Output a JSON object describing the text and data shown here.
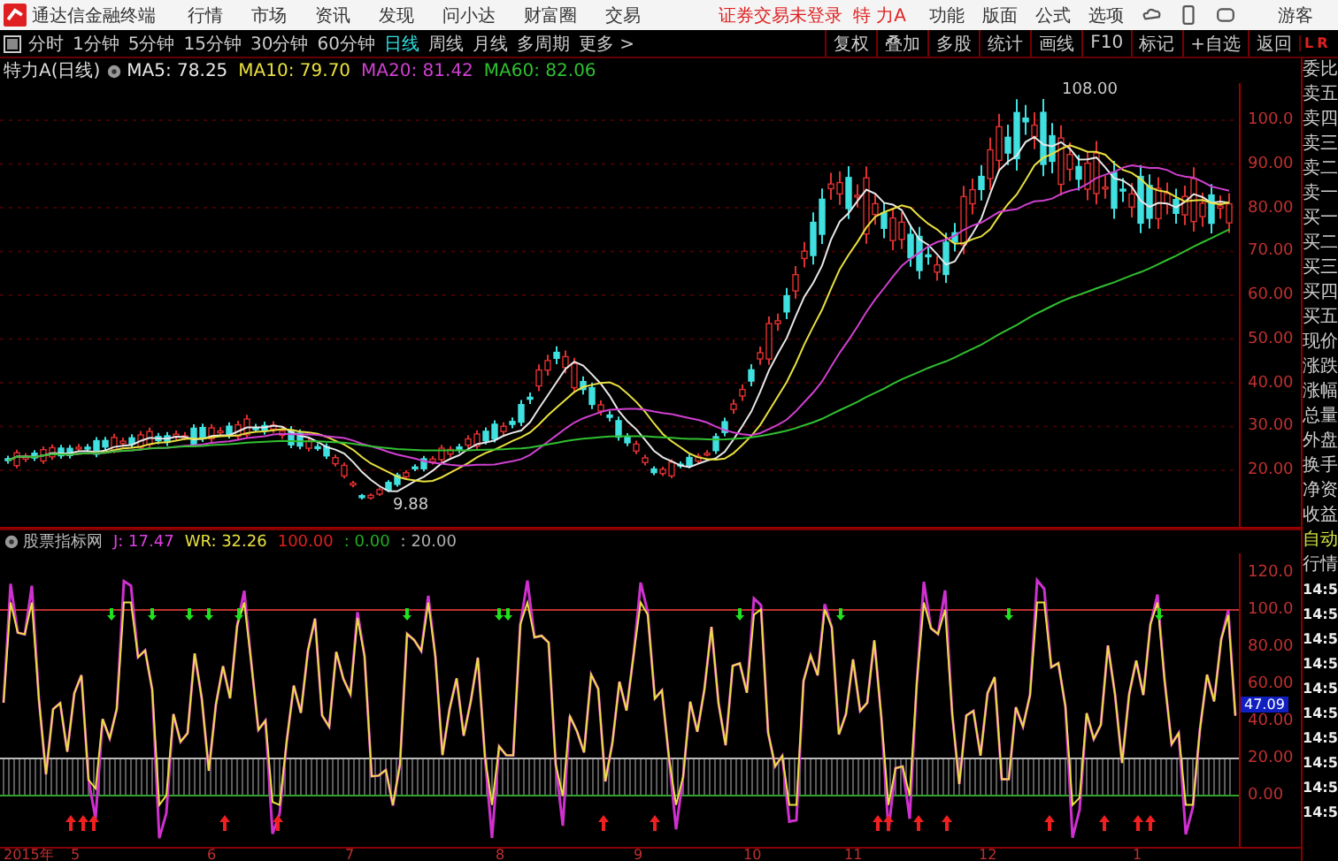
{
  "title_bar": {
    "app_name": "通达信金融终端",
    "menu": [
      "行情",
      "市场",
      "资讯",
      "发现",
      "问小达",
      "财富圈",
      "交易"
    ],
    "login_status": "证券交易未登录",
    "stock": "特 力A",
    "functions": [
      "功能",
      "版面",
      "公式",
      "选项"
    ],
    "user": "游客"
  },
  "period_tabs": [
    {
      "label": "分时",
      "selected": false
    },
    {
      "label": "1分钟",
      "selected": false
    },
    {
      "label": "5分钟",
      "selected": false
    },
    {
      "label": "15分钟",
      "selected": false
    },
    {
      "label": "30分钟",
      "selected": false
    },
    {
      "label": "60分钟",
      "selected": false
    },
    {
      "label": "日线",
      "selected": true
    },
    {
      "label": "周线",
      "selected": false
    },
    {
      "label": "月线",
      "selected": false
    },
    {
      "label": "多周期",
      "selected": false
    },
    {
      "label": "更多 >",
      "selected": false
    }
  ],
  "tool_buttons": [
    "复权",
    "叠加",
    "多股",
    "统计",
    "画线",
    "F10",
    "标记",
    "+自选",
    "返回"
  ],
  "side_switch": {
    "left": "L",
    "right": "R"
  },
  "ma_legend": {
    "title": "特力A(日线)",
    "items": [
      {
        "label": "MA5: 78.25",
        "color": "#e8e8e8"
      },
      {
        "label": "MA10: 79.70",
        "color": "#e8e040"
      },
      {
        "label": "MA20: 81.42",
        "color": "#d040d0"
      },
      {
        "label": "MA60: 82.06",
        "color": "#30c030"
      }
    ]
  },
  "price_chart": {
    "y_ticks": [
      "100.0",
      "90.00",
      "80.00",
      "70.00",
      "60.00",
      "50.00",
      "40.00",
      "30.00",
      "20.00"
    ],
    "high_label": "108.00",
    "low_label": "9.88"
  },
  "indicator": {
    "name": "股票指标网",
    "items": [
      {
        "label": "J: 17.47",
        "color": "#e040e0"
      },
      {
        "label": "WR: 32.26",
        "color": "#e8e040"
      },
      {
        "label": "100.00",
        "color": "#e02020"
      },
      {
        "label": ": 0.00",
        "color": "#20b020"
      },
      {
        "label": ": 20.00",
        "color": "#b0b0b0"
      }
    ],
    "y_ticks": [
      "120.0",
      "100.0",
      "80.00",
      "60.00",
      "40.00",
      "20.00",
      "0.00"
    ],
    "current_value": "47.09"
  },
  "date_axis": [
    "2015年",
    "5",
    "6",
    "7",
    "8",
    "9",
    "10",
    "11",
    "12",
    "1"
  ],
  "quote_panel": {
    "labels": [
      "委比",
      "卖五",
      "卖四",
      "卖三",
      "卖二",
      "卖一",
      "买一",
      "买二",
      "买三",
      "买四",
      "买五",
      "现价",
      "涨跌",
      "涨幅",
      "总量",
      "外盘",
      "换手",
      "净资",
      "收益"
    ],
    "auto": "自动",
    "section": "行情",
    "times": [
      "14:5",
      "14:5",
      "14:5",
      "14:5",
      "14:5",
      "14:5",
      "14:5",
      "14:5",
      "14:5",
      "14:5"
    ]
  }
}
